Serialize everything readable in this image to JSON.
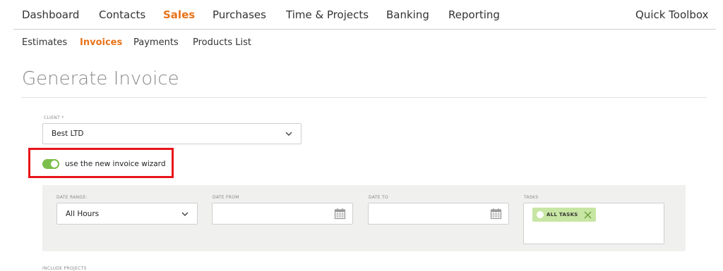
{
  "topnav": {
    "items": [
      "Dashboard",
      "Contacts",
      "Sales",
      "Purchases",
      "Time & Projects",
      "Banking",
      "Reporting"
    ],
    "active_index": 2,
    "quick_toolbox": "Quick Toolbox"
  },
  "subnav": {
    "items": [
      "Estimates",
      "Invoices",
      "Payments",
      "Products List"
    ],
    "active_index": 1
  },
  "page_title": "Generate Invoice",
  "client": {
    "label": "CLIENT *",
    "value": "Best LTD"
  },
  "wizard_toggle": {
    "label": "use the new invoice wizard",
    "on": true
  },
  "filters": {
    "date_range": {
      "label": "DATE RANGE:",
      "value": "All Hours"
    },
    "date_from": {
      "label": "DATE FROM",
      "value": ""
    },
    "date_to": {
      "label": "DATE TO",
      "value": ""
    },
    "tasks": {
      "label": "TASKS",
      "tag": "ALL TASKS"
    }
  },
  "include_projects_label": "INCLUDE PROJECTS",
  "colors": {
    "accent": "#e8731a",
    "toggle_on": "#7bbf4a",
    "highlight": "#e8141b",
    "tag_bg": "#c7e6a3",
    "panel_bg": "#f0f0ef"
  },
  "icons": [
    "chevron-down-icon",
    "calendar-icon",
    "close-icon"
  ]
}
